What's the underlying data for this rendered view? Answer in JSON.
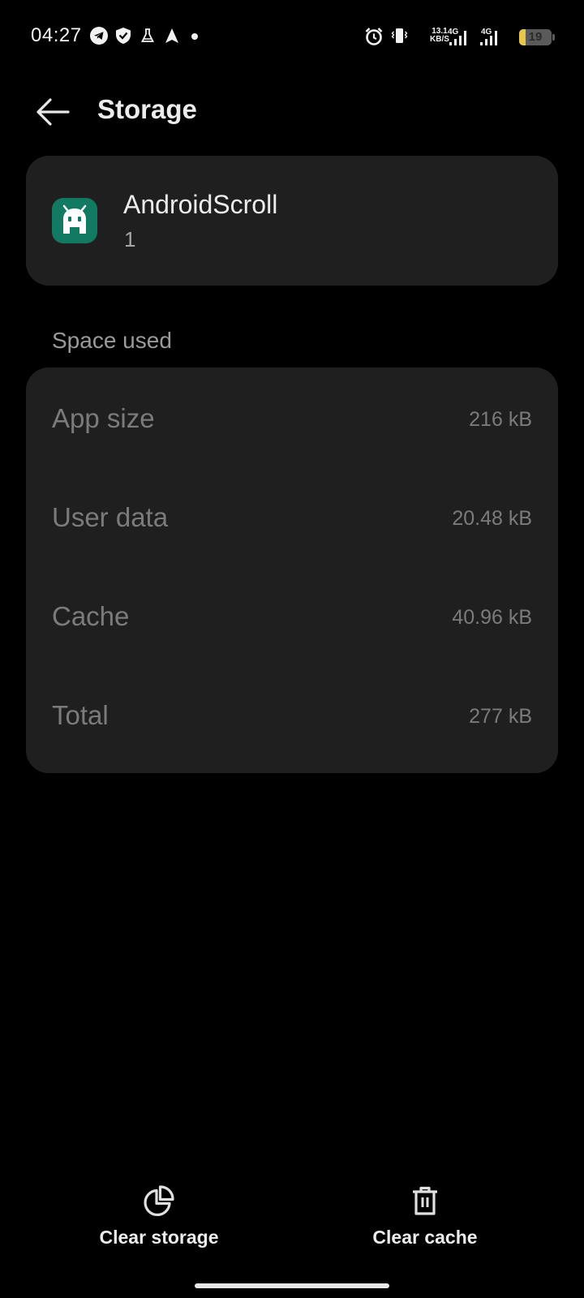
{
  "status_bar": {
    "time": "04:27",
    "net_speed_value": "13.1",
    "net_speed_unit": "KB/S",
    "network_1": "4G",
    "network_2": "4G",
    "battery_level": "19",
    "battery_fraction": 0.19,
    "icons": [
      "telegram-icon",
      "vpn-shield-icon",
      "flask-icon",
      "navigation-arrow-icon",
      "notification-dot",
      "alarm-icon",
      "vibrate-icon",
      "signal-icon",
      "signal-icon",
      "battery-icon"
    ]
  },
  "header": {
    "back_icon": "arrow-left-icon",
    "title": "Storage"
  },
  "app_info": {
    "name": "AndroidScroll",
    "version": "1",
    "icon": "android-app-icon",
    "icon_color": "#127a62"
  },
  "space_used": {
    "section_title": "Space used",
    "rows": [
      {
        "label": "App size",
        "value": "216 kB"
      },
      {
        "label": "User data",
        "value": "20.48 kB"
      },
      {
        "label": "Cache",
        "value": "40.96 kB"
      },
      {
        "label": "Total",
        "value": "277 kB"
      }
    ]
  },
  "actions": {
    "clear_storage": {
      "label": "Clear storage",
      "icon": "pie-chart-icon"
    },
    "clear_cache": {
      "label": "Clear cache",
      "icon": "trash-icon"
    }
  },
  "colors": {
    "background": "#000000",
    "card": "#1f1f1f",
    "text_primary": "#ececec",
    "text_muted": "#7b7b7b",
    "battery_accent": "#e7c64a"
  }
}
